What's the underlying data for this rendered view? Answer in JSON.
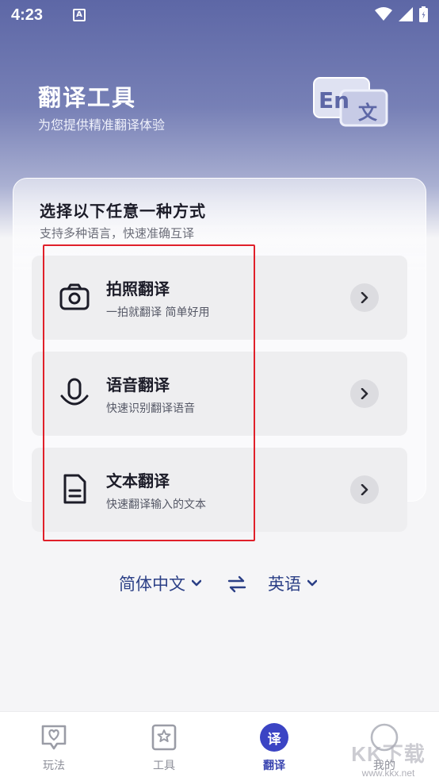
{
  "status_bar": {
    "time": "4:23",
    "a_badge": "A"
  },
  "header": {
    "title": "翻译工具",
    "subtitle": "为您提供精准翻译体验",
    "badge_en": "En",
    "badge_zh": "文"
  },
  "card": {
    "title": "选择以下任意一种方式",
    "subtitle": "支持多种语言，快速准确互译"
  },
  "options": [
    {
      "title": "拍照翻译",
      "subtitle": "一拍就翻译 简单好用",
      "icon": "camera-icon"
    },
    {
      "title": "语音翻译",
      "subtitle": "快速识别翻译语音",
      "icon": "microphone-icon"
    },
    {
      "title": "文本翻译",
      "subtitle": "快速翻译输入的文本",
      "icon": "document-icon"
    }
  ],
  "language": {
    "source": "简体中文",
    "target": "英语"
  },
  "tabs": [
    {
      "label": "玩法",
      "icon": "heart-frame-icon"
    },
    {
      "label": "工具",
      "icon": "star-bookmark-icon"
    },
    {
      "label": "翻译",
      "icon": "translate-icon",
      "glyph": "译",
      "active": true
    },
    {
      "label": "我的",
      "icon": "profile-icon"
    }
  ],
  "watermark": {
    "main": "KK下载",
    "url": "www.kkx.net"
  },
  "colors": {
    "accent": "#3b44c4",
    "header_top": "#5d67a6",
    "highlight": "#e0202a"
  }
}
